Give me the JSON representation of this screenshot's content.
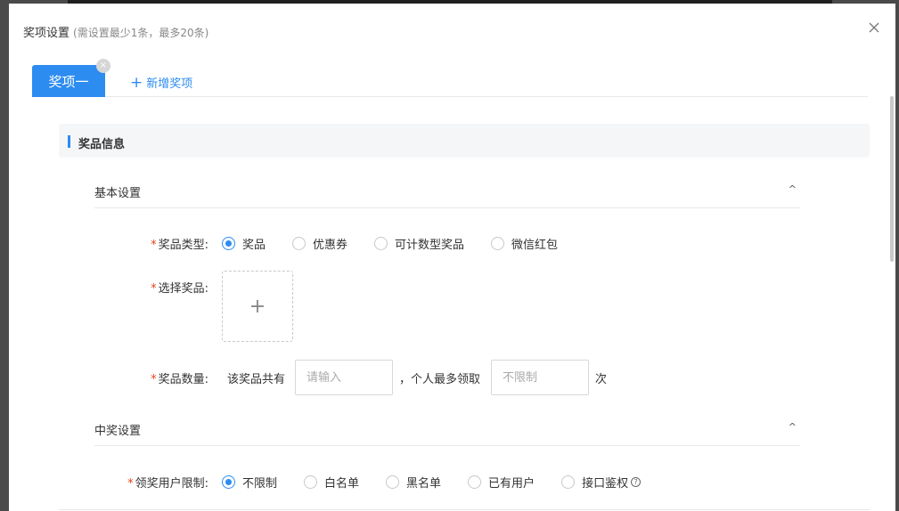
{
  "dialog": {
    "title": "奖项设置",
    "hint": "(需设置最少1条，最多20条)"
  },
  "tabs": {
    "active_label": "奖项一",
    "add_label": "新增奖项"
  },
  "section": {
    "title": "奖品信息"
  },
  "basic": {
    "title": "基本设置",
    "prize_type": {
      "label": "奖品类型:",
      "options": [
        "奖品",
        "优惠券",
        "可计数型奖品",
        "微信红包"
      ],
      "selected": "奖品"
    },
    "select_prize": {
      "label": "选择奖品:"
    },
    "prize_count": {
      "label": "奖品数量:",
      "prefix": "该奖品共有",
      "total_placeholder": "请输入",
      "middle": "，个人最多领取",
      "limit_placeholder": "不限制",
      "suffix": "次"
    }
  },
  "winning": {
    "title": "中奖设置",
    "user_limit": {
      "label": "领奖用户限制:",
      "options": [
        "不限制",
        "白名单",
        "黑名单",
        "已有用户",
        "接口鉴权"
      ],
      "selected": "不限制"
    }
  },
  "colors": {
    "accent": "#2d8cf0",
    "required": "#ed4014"
  }
}
